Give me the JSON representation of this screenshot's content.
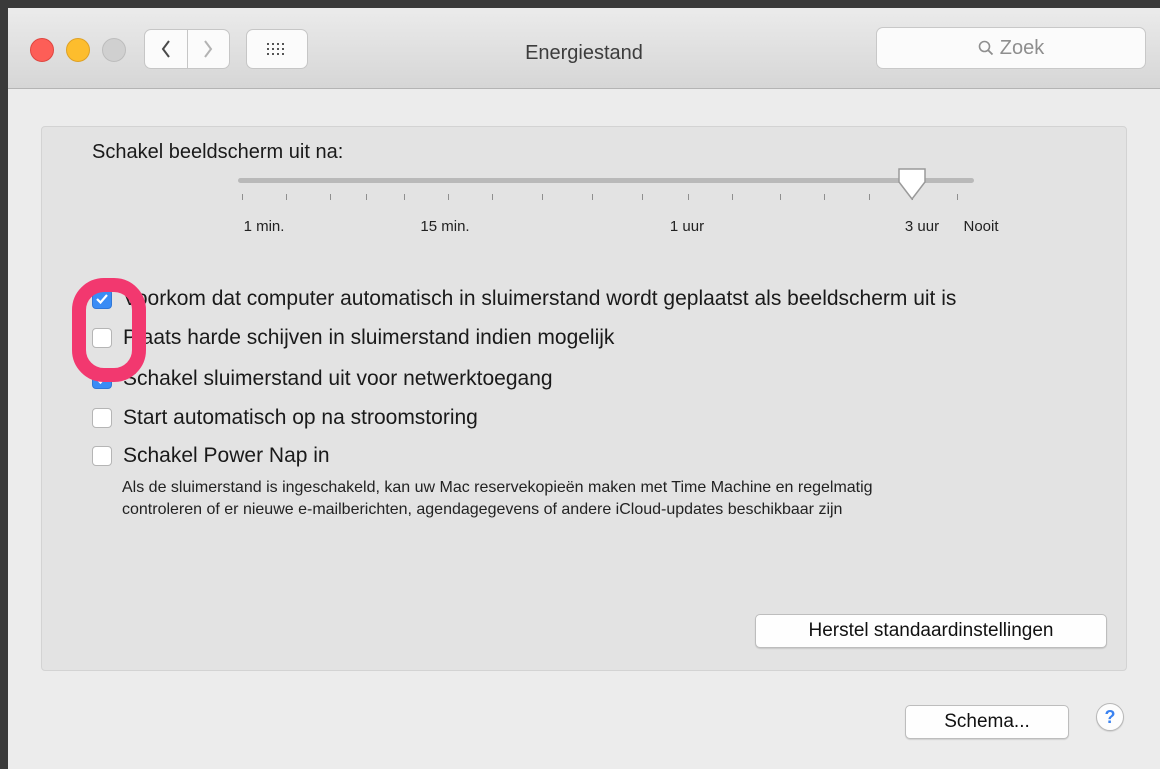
{
  "window": {
    "title": "Energiestand",
    "search_placeholder": "Zoek",
    "traffic_lights": {
      "close": "#fd5e57",
      "minimize": "#fdbd2d",
      "maximize": "#d0d0d0"
    },
    "nav": {
      "back_icon": "chevron-left-icon",
      "forward_icon": "chevron-right-icon",
      "grid_icon": "grid-icon"
    }
  },
  "display_sleep": {
    "label": "Schakel beeldscherm uit na:",
    "tick_labels": [
      "1 min.",
      "15 min.",
      "1 uur",
      "3 uur",
      "Nooit"
    ],
    "selected": "3 uur"
  },
  "options": [
    {
      "label": "Voorkom dat computer automatisch in sluimerstand wordt geplaatst als beeldscherm uit is",
      "checked": true
    },
    {
      "label": "Plaats harde schijven in sluimerstand indien mogelijk",
      "checked": false
    },
    {
      "label": "Schakel sluimerstand uit voor netwerktoegang",
      "checked": true
    },
    {
      "label": "Start automatisch op na stroomstoring",
      "checked": false
    },
    {
      "label": "Schakel Power Nap in",
      "checked": false
    }
  ],
  "power_nap_description": {
    "line1": "Als de sluimerstand is ingeschakeld, kan uw Mac reservekopieën maken met Time Machine en regelmatig",
    "line2": "controleren of er nieuwe e-mailberichten, agendagegevens of andere iCloud-updates beschikbaar zijn"
  },
  "buttons": {
    "restore_defaults": "Herstel standaardinstellingen",
    "schedule": "Schema...",
    "help": "?"
  },
  "colors": {
    "accent": "#3a8cf5",
    "highlight": "#f2386f"
  }
}
